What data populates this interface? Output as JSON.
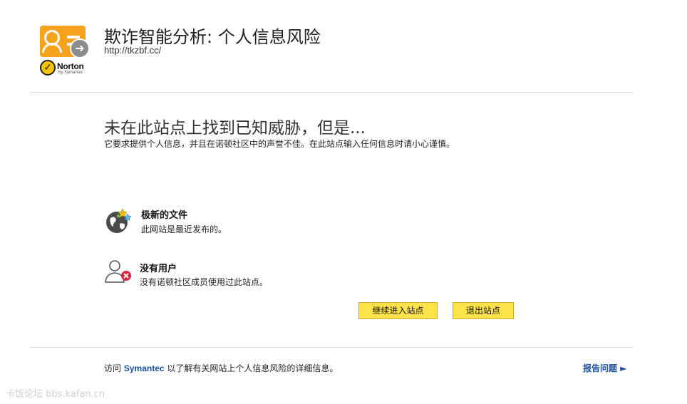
{
  "header": {
    "title": "欺诈智能分析: 个人信息风险",
    "url": "http://tkzbf.cc/",
    "logo_text": "Norton",
    "logo_subtext": "by Symantec"
  },
  "main": {
    "headline": "未在此站点上找到已知威胁，但是...",
    "subline": "它要求提供个人信息，并且在诺顿社区中的声誉不佳。在此站点输入任何信息时请小心谨慎。",
    "features": [
      {
        "icon": "globe-stars-icon",
        "title": "极新的文件",
        "desc": "此网站是最近发布的。"
      },
      {
        "icon": "user-x-icon",
        "title": "没有用户",
        "desc": "没有诺顿社区成员使用过此站点。"
      }
    ],
    "buttons": {
      "continue": "继续进入站点",
      "exit": "退出站点"
    }
  },
  "footer": {
    "prefix": "访问",
    "link": "Symantec",
    "suffix": "以了解有关网站上个人信息风险的详细信息。",
    "report": "报告问题 ►"
  },
  "watermark": "卡饭论坛 bbs.kafan.cn",
  "colors": {
    "accent_orange": "#f5a31c",
    "button_yellow": "#fce34a",
    "link_blue": "#1a4fa0",
    "alert_red": "#d7263d"
  }
}
